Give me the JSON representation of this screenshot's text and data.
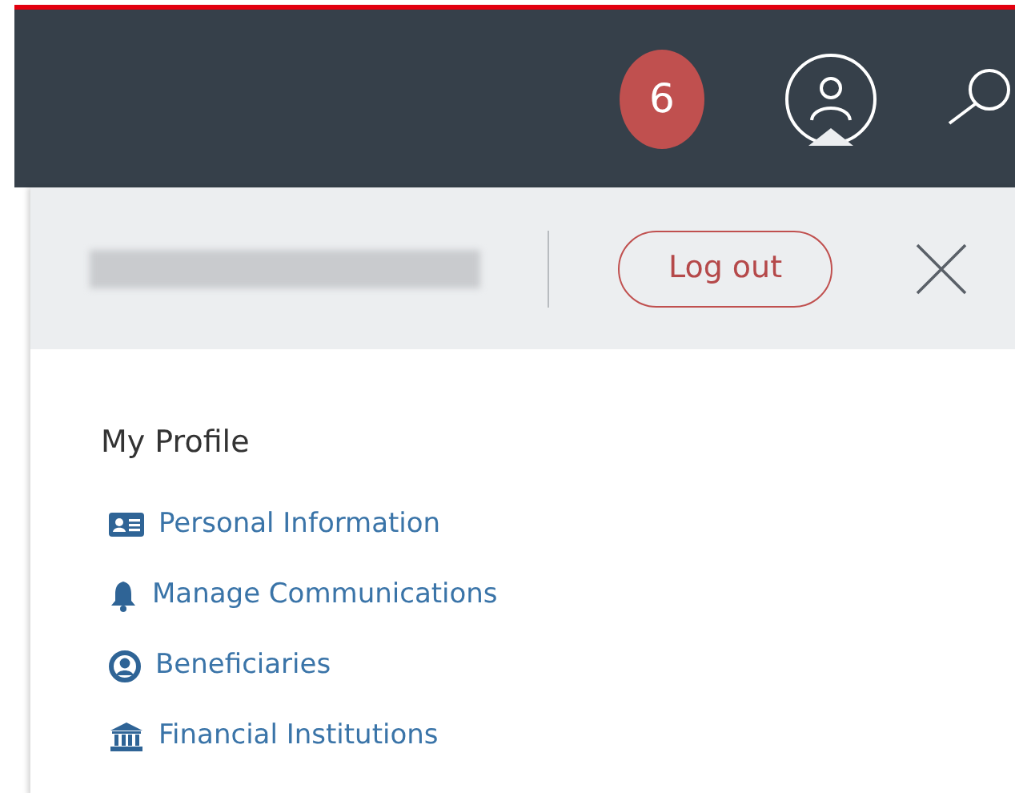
{
  "header": {
    "notification_count": "6"
  },
  "account_panel": {
    "logout_button": "Log out"
  },
  "profile_menu": {
    "title": "My Profile",
    "items": [
      {
        "kind": "id-card",
        "label": "Personal Information"
      },
      {
        "kind": "bell",
        "label": "Manage Communications"
      },
      {
        "kind": "person",
        "label": "Beneficiaries"
      },
      {
        "kind": "bank",
        "label": "Financial Institutions"
      }
    ]
  }
}
